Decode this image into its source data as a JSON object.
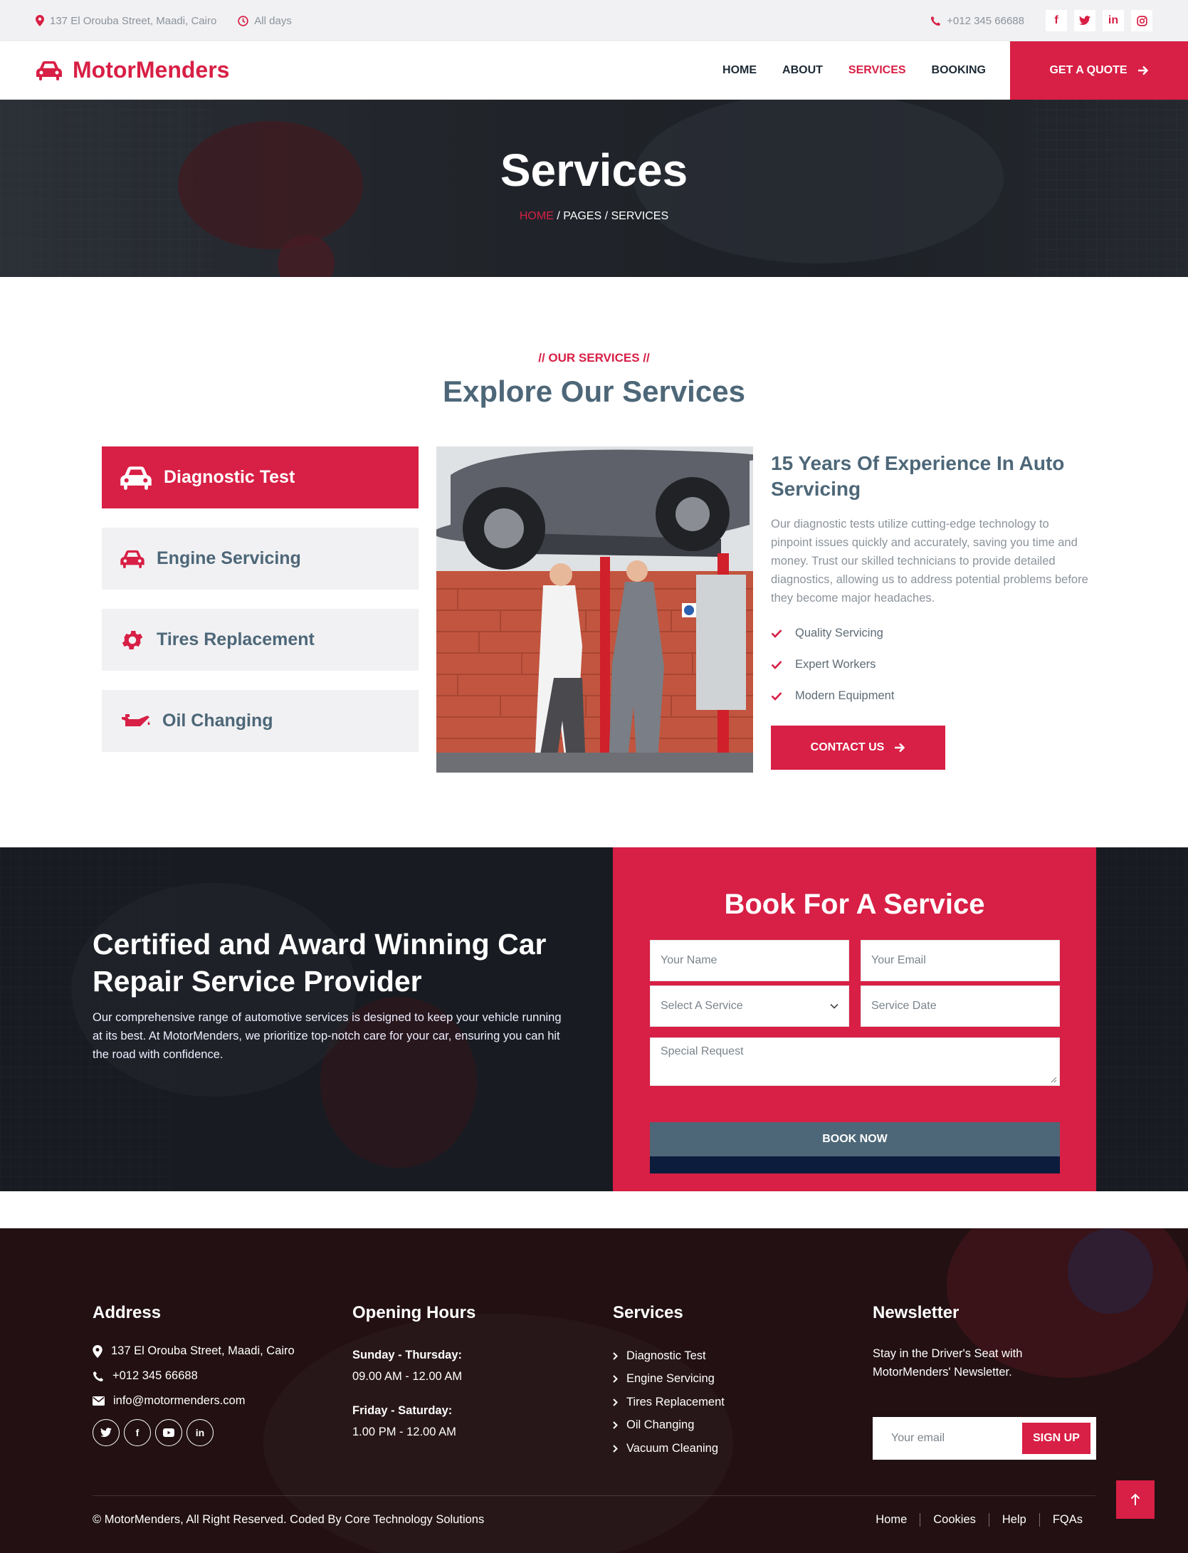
{
  "topbar": {
    "address": "137 El Orouba Street, Maadi, Cairo",
    "hours": "All days",
    "phone": "+012 345 66688",
    "social": [
      "f",
      "twitter",
      "in",
      "instagram"
    ]
  },
  "nav": {
    "brand": "MotorMenders",
    "items": [
      "HOME",
      "ABOUT",
      "SERVICES",
      "BOOKING"
    ],
    "active": "SERVICES",
    "cta": "GET A QUOTE"
  },
  "hero": {
    "title": "Services",
    "breadcrumb": [
      "HOME",
      "PAGES",
      "SERVICES"
    ]
  },
  "services": {
    "tag": "// OUR SERVICES //",
    "title": "Explore Our Services",
    "tabs": [
      "Diagnostic Test",
      "Engine Servicing",
      "Tires Replacement",
      "Oil Changing"
    ],
    "active_tab": "Diagnostic Test",
    "detail": {
      "heading": "15 Years Of Experience In Auto Servicing",
      "body": "Our diagnostic tests utilize cutting-edge technology to pinpoint issues quickly and accurately, saving you time and money. Trust our skilled technicians to provide detailed diagnostics, allowing us to address potential problems before they become major headaches.",
      "checks": [
        "Quality Servicing",
        "Expert Workers",
        "Modern Equipment"
      ],
      "button": "CONTACT US"
    }
  },
  "booking": {
    "headline": "Certified and Award Winning Car Repair Service Provider",
    "body": "Our comprehensive range of automotive services is designed to keep your vehicle running at its best. At MotorMenders, we prioritize top-notch care for your car, ensuring you can hit the road with confidence.",
    "form_title": "Book For A Service",
    "name_placeholder": "Your Name",
    "email_placeholder": "Your Email",
    "service_select": "Select A Service",
    "date_placeholder": "Service Date",
    "request_placeholder": "Special Request",
    "button": "BOOK NOW"
  },
  "footer": {
    "address_title": "Address",
    "address": "137 El Orouba Street, Maadi, Cairo",
    "phone": "+012 345 66688",
    "email": "info@motormenders.com",
    "hours_title": "Opening Hours",
    "hours": [
      {
        "days": "Sunday - Thursday:",
        "time": "09.00 AM - 12.00 AM"
      },
      {
        "days": "Friday - Saturday:",
        "time": "1.00 PM - 12.00 AM"
      }
    ],
    "services_title": "Services",
    "services": [
      "Diagnostic Test",
      "Engine Servicing",
      "Tires Replacement",
      "Oil Changing",
      "Vacuum Cleaning"
    ],
    "newsletter_title": "Newsletter",
    "newsletter_text": "Stay in the Driver's Seat with MotorMenders' Newsletter.",
    "newsletter_placeholder": "Your email",
    "signup": "SIGN UP",
    "copyright": "© MotorMenders, All Right Reserved. Coded By Core Technology Solutions",
    "links": [
      "Home",
      "Cookies",
      "Help",
      "FQAs"
    ]
  },
  "colors": {
    "accent": "#d81f45",
    "slate": "#4d6778",
    "navy": "#0c1c3d"
  }
}
